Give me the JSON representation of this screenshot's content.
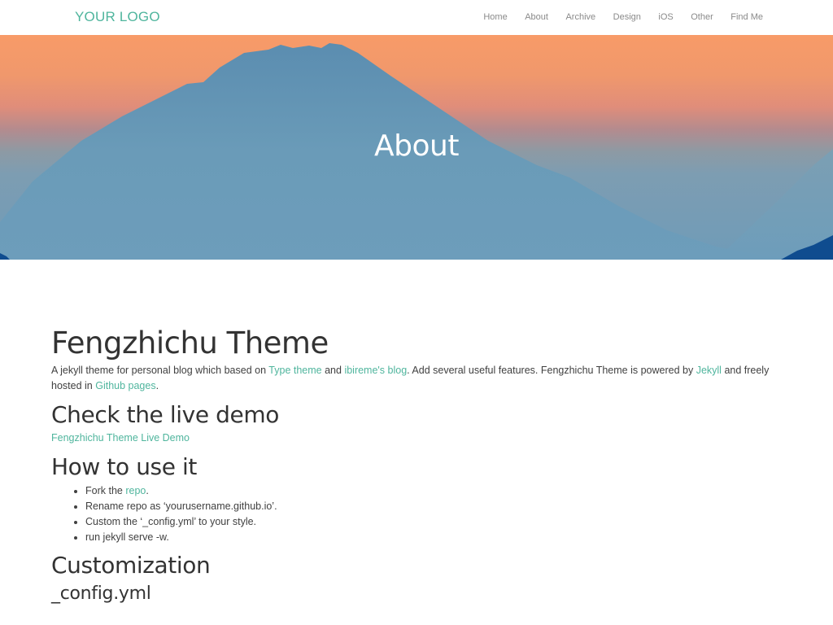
{
  "navbar": {
    "logo": "YOUR LOGO",
    "links": [
      "Home",
      "About",
      "Archive",
      "Design",
      "iOS",
      "Other",
      "Find Me"
    ]
  },
  "hero": {
    "title": "About"
  },
  "colors": {
    "accent": "#4fb59d",
    "text": "#404040",
    "heading": "#333333",
    "nav_text": "#8a8a8a"
  },
  "content": {
    "title": "Fengzhichu Theme",
    "intro": {
      "t1": "A jekyll theme for personal blog which based on ",
      "link1": "Type theme",
      "t2": " and ",
      "link2": "ibireme's blog",
      "t3": ". Add several useful features. Fengzhichu Theme is powered by ",
      "link3": "Jekyll",
      "t4": " and freely hosted in ",
      "link4": "Github pages",
      "t5": "."
    },
    "demo_heading": "Check the live demo",
    "demo_link": "Fengzhichu Theme Live Demo",
    "howto_heading": "How to use it",
    "howto": {
      "item1_text": "Fork the ",
      "item1_link": "repo",
      "item1_end": ".",
      "item2": "Rename repo as ‘yourusername.github.io’.",
      "item3": "Custom the ‘_config.yml’ to your style.",
      "item4": "run jekyll serve -w."
    },
    "custom_heading": "Customization",
    "config_heading": "_config.yml"
  }
}
